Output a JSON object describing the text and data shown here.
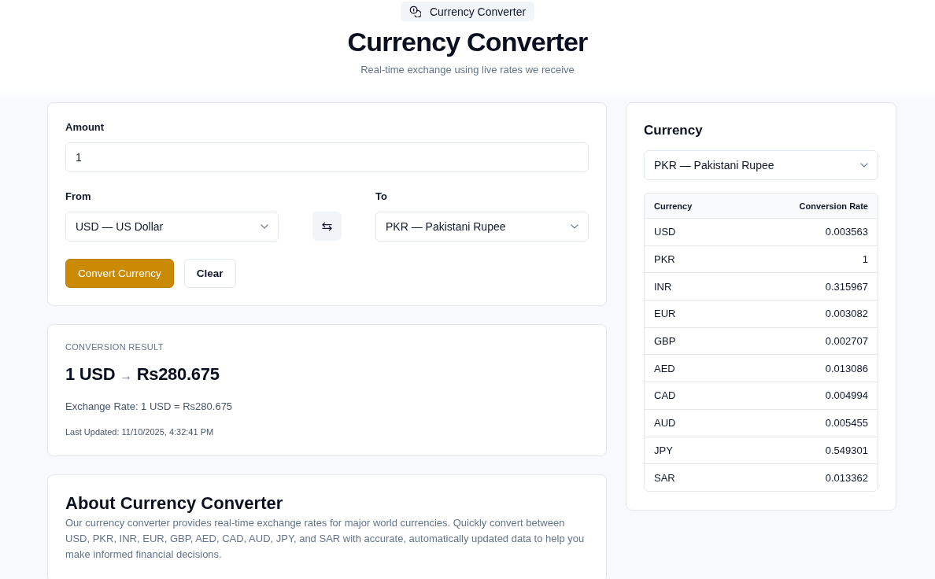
{
  "header": {
    "badge": "Currency Converter",
    "title": "Currency Converter",
    "subtitle": "Real-time exchange using live rates we receive"
  },
  "converter": {
    "amount": {
      "label": "Amount",
      "value": "1"
    },
    "from": {
      "label": "From",
      "value": "USD — US Dollar"
    },
    "to": {
      "label": "To",
      "value": "PKR — Pakistani Rupee"
    },
    "buttons": [
      {
        "label": "Convert Currency",
        "kind": "primary"
      },
      {
        "label": "Clear",
        "kind": "secondary"
      }
    ]
  },
  "result": {
    "label": "CONVERSION RESULT",
    "from_amount": "1 USD",
    "arrow": "→",
    "to_amount": "Rs280.675",
    "rate": "Exchange Rate: 1 USD = Rs280.675",
    "updated": "Last Updated: 11/10/2025, 4:32:41 PM"
  },
  "about": {
    "title": "About Currency Converter",
    "text": "Our currency converter provides real-time exchange rates for major world currencies. Quickly convert between USD, PKR, INR, EUR, GBP, AED, CAD, AUD, JPY, and SAR with accurate, automatically updated data to help you make informed financial decisions."
  },
  "rates_panel": {
    "title": "Currency",
    "select_value": "PKR — Pakistani Rupee",
    "table": {
      "columns": [
        "Currency",
        "Conversion Rate"
      ],
      "rows": [
        {
          "currency": "USD",
          "rate": "0.003563"
        },
        {
          "currency": "PKR",
          "rate": "1"
        },
        {
          "currency": "INR",
          "rate": "0.315967"
        },
        {
          "currency": "EUR",
          "rate": "0.003082"
        },
        {
          "currency": "GBP",
          "rate": "0.002707"
        },
        {
          "currency": "AED",
          "rate": "0.013086"
        },
        {
          "currency": "CAD",
          "rate": "0.004994"
        },
        {
          "currency": "AUD",
          "rate": "0.005455"
        },
        {
          "currency": "JPY",
          "rate": "0.549301"
        },
        {
          "currency": "SAR",
          "rate": "0.013362"
        }
      ]
    }
  }
}
